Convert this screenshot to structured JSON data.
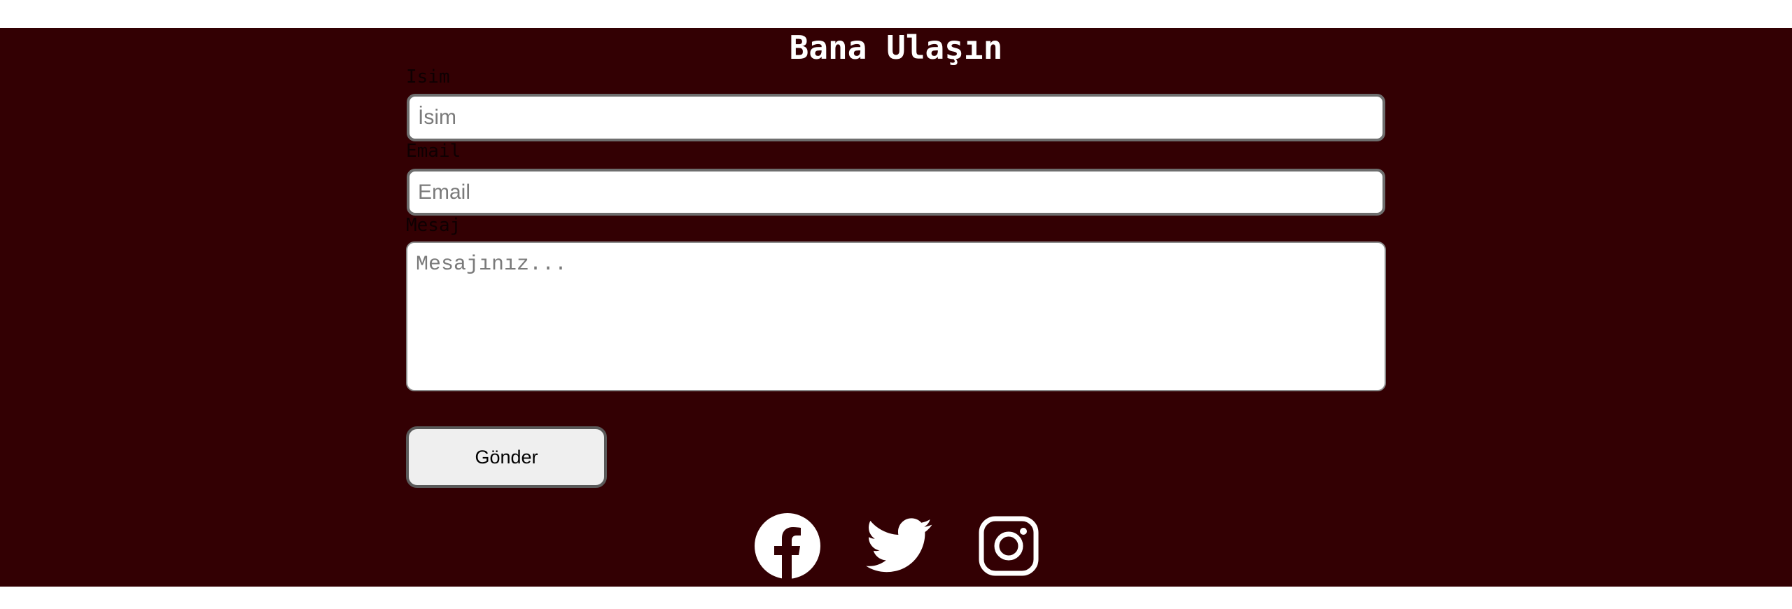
{
  "contact": {
    "title": "Bana Ulaşın",
    "name_label": "Isim",
    "name_placeholder": "İsim",
    "email_label": "Email",
    "email_placeholder": "Email",
    "message_label": "Mesaj",
    "message_placeholder": "Mesajınız...",
    "submit_label": "Gönder"
  },
  "social": [
    {
      "icon": "facebook-icon"
    },
    {
      "icon": "twitter-icon"
    },
    {
      "icon": "instagram-icon"
    }
  ],
  "colors": {
    "band": "#330003",
    "title": "#ffffff",
    "label": "#0e0002",
    "icon": "#ffffff"
  }
}
